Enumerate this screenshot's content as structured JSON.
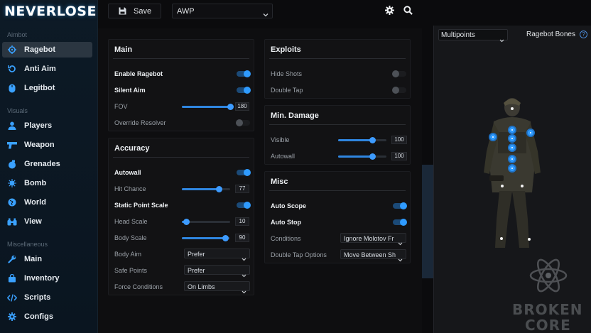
{
  "app": {
    "logo": "NEVERLOSE",
    "accent": "#2f9bff"
  },
  "sidebar": {
    "sections": [
      {
        "label": "Aimbot"
      },
      {
        "label": "Visuals"
      },
      {
        "label": "Miscellaneous"
      }
    ],
    "items": [
      {
        "label": "Ragebot",
        "icon": "crosshair-icon",
        "active": true
      },
      {
        "label": "Anti Aim",
        "icon": "rotate-icon"
      },
      {
        "label": "Legitbot",
        "icon": "mouse-icon"
      },
      {
        "label": "Players",
        "icon": "person-icon"
      },
      {
        "label": "Weapon",
        "icon": "gun-icon"
      },
      {
        "label": "Grenades",
        "icon": "grenade-icon"
      },
      {
        "label": "Bomb",
        "icon": "bomb-icon"
      },
      {
        "label": "World",
        "icon": "globe-icon"
      },
      {
        "label": "View",
        "icon": "binoculars-icon"
      },
      {
        "label": "Main",
        "icon": "wrench-icon"
      },
      {
        "label": "Inventory",
        "icon": "bag-icon"
      },
      {
        "label": "Scripts",
        "icon": "code-icon"
      },
      {
        "label": "Configs",
        "icon": "gear-icon"
      }
    ]
  },
  "topbar": {
    "save_label": "Save",
    "config_select": "AWP"
  },
  "main_panel": {
    "title": "Main",
    "rows": {
      "enable_ragebot": {
        "label": "Enable Ragebot",
        "on": true
      },
      "silent_aim": {
        "label": "Silent Aim",
        "on": true
      },
      "fov": {
        "label": "FOV",
        "value": "180",
        "fraction": 1.0
      },
      "override_resolver": {
        "label": "Override Resolver",
        "on": false
      }
    }
  },
  "accuracy_panel": {
    "title": "Accuracy",
    "rows": {
      "autowall": {
        "label": "Autowall",
        "on": true
      },
      "hit_chance": {
        "label": "Hit Chance",
        "value": "77",
        "fraction": 0.77
      },
      "static_point_scale": {
        "label": "Static Point Scale",
        "on": true
      },
      "head_scale": {
        "label": "Head Scale",
        "value": "10",
        "fraction": 0.1
      },
      "body_scale": {
        "label": "Body Scale",
        "value": "90",
        "fraction": 0.9
      },
      "body_aim": {
        "label": "Body Aim",
        "value": "Prefer"
      },
      "safe_points": {
        "label": "Safe Points",
        "value": "Prefer"
      },
      "force_conditions": {
        "label": "Force Conditions",
        "value": "On Limbs"
      }
    }
  },
  "exploits_panel": {
    "title": "Exploits",
    "rows": {
      "hide_shots": {
        "label": "Hide Shots",
        "on": false
      },
      "double_tap": {
        "label": "Double Tap",
        "on": false
      }
    }
  },
  "min_damage_panel": {
    "title": "Min. Damage",
    "rows": {
      "visible": {
        "label": "Visible",
        "value": "100",
        "fraction": 0.72
      },
      "autowall": {
        "label": "Autowall",
        "value": "100",
        "fraction": 0.72
      }
    }
  },
  "misc_panel": {
    "title": "Misc",
    "rows": {
      "auto_scope": {
        "label": "Auto Scope",
        "on": true
      },
      "auto_stop": {
        "label": "Auto Stop",
        "on": true
      },
      "conditions": {
        "label": "Conditions",
        "value": "Ignore Molotov Fr"
      },
      "double_tap_options": {
        "label": "Double Tap Options",
        "value": "Move Between Sh"
      }
    }
  },
  "preview": {
    "multipoint_select": "Multipoints",
    "bones_label": "Ragebot Bones",
    "help": "?",
    "watermark": {
      "line1": "BROKEN",
      "line2": "CORE"
    }
  }
}
